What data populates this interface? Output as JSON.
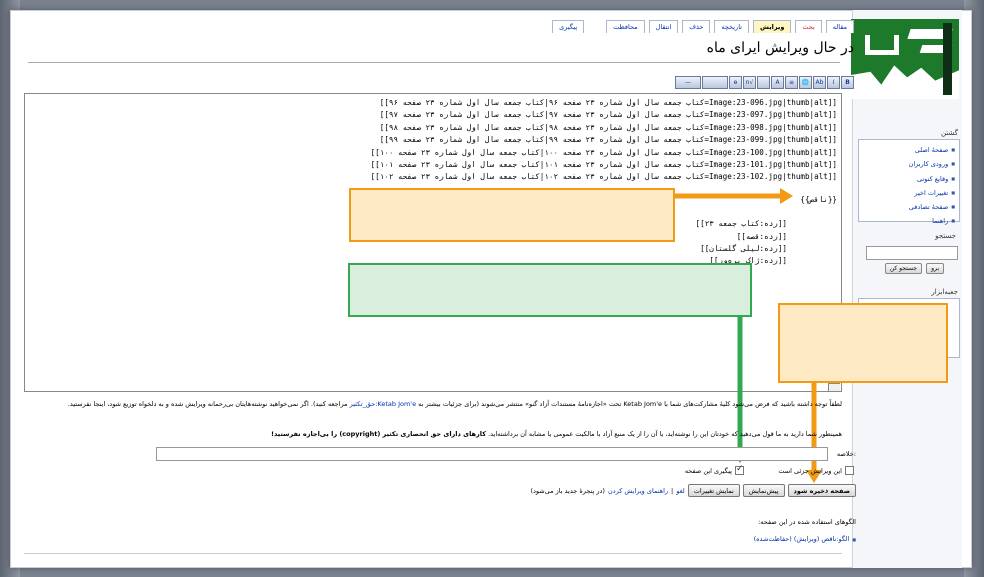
{
  "tabs": [
    {
      "label": "مقاله",
      "selected": false,
      "red": false
    },
    {
      "label": "بحث",
      "selected": false,
      "red": true
    },
    {
      "label": "ویرایش",
      "selected": true,
      "red": false
    },
    {
      "label": "تاریخچه",
      "selected": false,
      "red": false
    },
    {
      "label": "حذف",
      "selected": false,
      "red": false
    },
    {
      "label": "انتقال",
      "selected": false,
      "red": false
    },
    {
      "label": "محافظت",
      "selected": false,
      "red": false
    },
    {
      "label": "پیگیری",
      "selected": false,
      "red": false
    }
  ],
  "page_title": "در حال ویرایش ایرای ماه",
  "toolbar": [
    "B",
    "I",
    "Ab",
    "🌐",
    "≡",
    "A",
    "√n",
    "ɵ",
    "—"
  ],
  "editor_lines": [
    "[[Image:23-096.jpg|thumb|alt=کتاب جمعه سال اول شماره ۲۳ صفحه ۹۶|کتاب جمعه سال اول شماره ۲۳ صفحه ۹۶]]",
    "[[Image:23-097.jpg|thumb|alt=کتاب جمعه سال اول شماره ۲۳ صفحه ۹۷|کتاب جمعه سال اول شماره ۲۳ صفحه ۹۷]]",
    "[[Image:23-098.jpg|thumb|alt=کتاب جمعه سال اول شماره ۲۳ صفحه ۹۸|کتاب جمعه سال اول شماره ۲۳ صفحه ۹۸]]",
    "[[Image:23-099.jpg|thumb|alt=کتاب جمعه سال اول شماره ۲۳ صفحه ۹۹|کتاب جمعه سال اول شماره ۲۳ صفحه ۹۹]]",
    "[[Image:23-100.jpg|thumb|alt=کتاب جمعه سال اول شماره ۲۳ صفحه ۱۰۰|کتاب جمعه سال اول شماره ۲۳ صفحه ۱۰۰]]",
    "[[Image:23-101.jpg|thumb|alt=کتاب جمعه سال اول شماره ۲۳ صفحه ۱۰۱|کتاب جمعه سال اول شماره ۲۳ صفحه ۱۰۱]]",
    "[[Image:23-102.jpg|thumb|alt=کتاب جمعه سال اول شماره ۲۳ صفحه ۱۰۲|کتاب جمعه سال اول شماره ۲۳ صفحه ۱۰۲]]"
  ],
  "editor_template": "{{ناقص}}",
  "editor_categories": [
    "[[رده:کتاب جمعه ۲۳]]",
    "[[رده:قصه]]",
    "[[رده:لیلی گلستان]]",
    "[[رده:ژاک پره‌ور]]"
  ],
  "sidebar": {
    "nav_title": "گشتن",
    "nav_items": [
      "صفحهٔ اصلی",
      "ورودی کاربران",
      "وقایع کنونی",
      "تغییرات اخیر",
      "صفحهٔ تصادفی",
      "راهنما"
    ],
    "search_title": "جستجو",
    "search_go": "برو",
    "search_button": "جستجو کن",
    "toolbox_title": "جعبه‌ابزار"
  },
  "notice": {
    "line1_pre": "لطفاً توجه داشته باشید که فرض می‌شود کلیهٔ مشارکت‌های شما با Ketab Jom'e تحت «اجازه‌نامهٔ مستندات آزاد گنو» منتشر می‌شوند (برای جزئیات بیشتر به ",
    "line1_link": "Ketab Jom'e:حق_تکثیر",
    "line1_post": " مراجعه کنید). اگر نمی‌خواهید نوشته‌هایتان بی‌رحمانه ویرایش شده و به دلخواه توزیع شود، اینجا نفرستید.",
    "line2_pre": "همینطور شما دارید به ما قول می‌دهید که خودتان این را نوشته‌اید، یا آن را از یک منبع آزاد با مالکیت عمومی یا مشابه آن برداشته‌اید. ",
    "line2_bold": "کارهای دارای حق انحصاری تکثیر (copyright) را بی‌اجازه نفرستید!"
  },
  "summary_label": "خلاصه:",
  "minor_label": "این ویرایش جزئی است",
  "watch_label": "پیگیری این صفحه",
  "minor_checked": false,
  "watch_checked": true,
  "buttons": {
    "save": "صفحه ذخیره شود",
    "preview": "پیش‌نمایش",
    "diff": "نمایش تغییرات"
  },
  "cancel_link": "لغو",
  "help_link": "راهنمای ویرایش کردن",
  "help_note": "(در پنجرهٔ جدید باز می‌شود)",
  "templates_heading": "الگوهای استفاده شده در این صفحه:",
  "template_item": "الگو:ناقص (ویرایش) (حفاظت‌شده)",
  "colors": {
    "orange": "#f29a14",
    "green": "#33a852",
    "orange_fill": "#fde9c4",
    "green_fill": "#daeedd"
  }
}
